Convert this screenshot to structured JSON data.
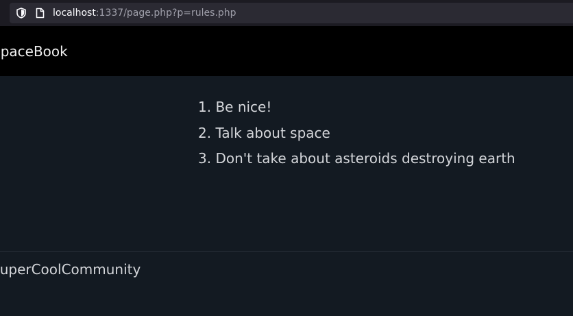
{
  "browser": {
    "url_host": "localhost",
    "url_rest": ":1337/page.php?p=rules.php"
  },
  "header": {
    "brand": "SpaceBook"
  },
  "rules": [
    "1. Be nice!",
    "2. Talk about space",
    "3. Don't take about asteroids destroying earth"
  ],
  "footer": {
    "text": "SuperCoolCommunity"
  }
}
